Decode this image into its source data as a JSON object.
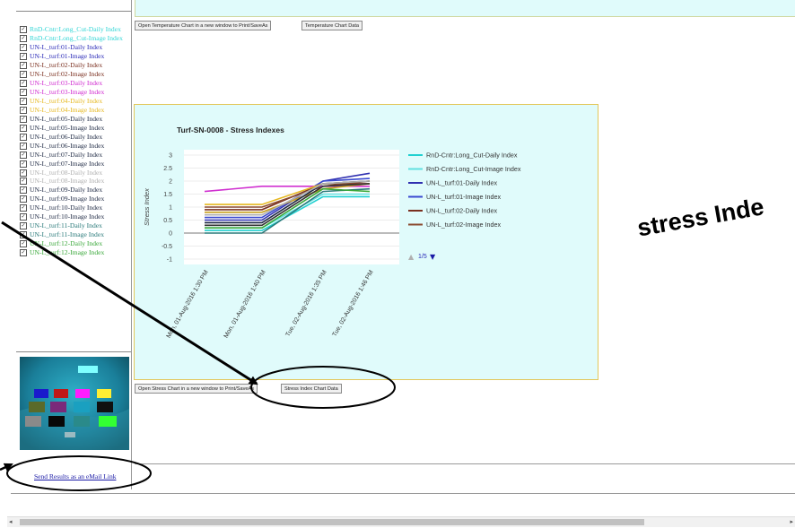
{
  "sidebar": {
    "series": [
      {
        "label": "RnD-Cntr:Long_Cut-Daily Index",
        "color": "#33d6d6",
        "checked": true
      },
      {
        "label": "RnD-Cntr:Long_Cut-Image Index",
        "color": "#33d6d6",
        "checked": true
      },
      {
        "label": "UN-L_turf:01-Daily Index",
        "color": "#2a2ab8",
        "checked": true
      },
      {
        "label": "UN-L_turf:01-Image Index",
        "color": "#2a2ab8",
        "checked": true
      },
      {
        "label": "UN-L_turf:02-Daily Index",
        "color": "#7a2e1e",
        "checked": true
      },
      {
        "label": "UN-L_turf:02-Image Index",
        "color": "#7a2e1e",
        "checked": true
      },
      {
        "label": "UN-L_turf:03-Daily Index",
        "color": "#d02ad0",
        "checked": true
      },
      {
        "label": "UN-L_turf:03-Image Index",
        "color": "#d02ad0",
        "checked": true
      },
      {
        "label": "UN-L_turf:04-Daily Index",
        "color": "#e6b820",
        "checked": true
      },
      {
        "label": "UN-L_turf:04-Image Index",
        "color": "#e6b820",
        "checked": true
      },
      {
        "label": "UN-L_turf:05-Daily Index",
        "color": "#1f2a44",
        "checked": true
      },
      {
        "label": "UN-L_turf:05-Image Index",
        "color": "#1f2a44",
        "checked": true
      },
      {
        "label": "UN-L_turf:06-Daily Index",
        "color": "#1f2a44",
        "checked": true
      },
      {
        "label": "UN-L_turf:06-Image Index",
        "color": "#1f2a44",
        "checked": true
      },
      {
        "label": "UN-L_turf:07-Daily Index",
        "color": "#1f2a44",
        "checked": true
      },
      {
        "label": "UN-L_turf:07-Image Index",
        "color": "#1f2a44",
        "checked": true
      },
      {
        "label": "UN-L_turf:08-Daily Index",
        "color": "#b0b0b0",
        "checked": true
      },
      {
        "label": "UN-L_turf:08-Image Index",
        "color": "#b0b0b0",
        "checked": true
      },
      {
        "label": "UN-L_turf:09-Daily Index",
        "color": "#1f2a44",
        "checked": true
      },
      {
        "label": "UN-L_turf:09-Image Index",
        "color": "#1f2a44",
        "checked": true
      },
      {
        "label": "UN-L_turf:10-Daily Index",
        "color": "#1f2a44",
        "checked": true
      },
      {
        "label": "UN-L_turf:10-Image Index",
        "color": "#1f2a44",
        "checked": true
      },
      {
        "label": "UN-L_turf:11-Daily Index",
        "color": "#2a7a7a",
        "checked": true
      },
      {
        "label": "UN-L_turf:11-Image Index",
        "color": "#2a7a7a",
        "checked": true
      },
      {
        "label": "UN-L_turf:12-Daily Index",
        "color": "#3aa83a",
        "checked": true
      },
      {
        "label": "UN-L_turf:12-Image Index",
        "color": "#3aa83a",
        "checked": true
      }
    ],
    "mail_link": "Send Results as an eMail Link"
  },
  "temperature": {
    "open_button": "Open Temperature Chart in a new window to Print/SaveAs",
    "data_button": "Temperature Chart Data"
  },
  "stress": {
    "open_button": "Open Stress Chart in a new window to Print/SaveAs",
    "data_button": "Stress Index Chart Data",
    "legend_pager": "1/5"
  },
  "callout": {
    "text": "stress Inde"
  },
  "chart_data": {
    "type": "line",
    "title": "Turf-SN-0008 - Stress Indexes",
    "ylabel": "Stress Index",
    "xlabel": "",
    "ylim": [
      -1,
      3
    ],
    "yticks": [
      3,
      2.5,
      2,
      1.5,
      1,
      0.5,
      0,
      -0.5,
      -1
    ],
    "categories": [
      "Mon, 01-Aug-2016 1:30 PM",
      "Mon, 01-Aug-2016 1:40 PM",
      "Tue, 02-Aug-2016 1:35 PM",
      "Tue, 02-Aug-2016 1:46 PM"
    ],
    "legend_position": "right",
    "series": [
      {
        "name": "RnD-Cntr:Long_Cut-Daily Index",
        "color": "#20d0d0",
        "values": [
          0.1,
          0.1,
          1.4,
          1.4
        ]
      },
      {
        "name": "RnD-Cntr:Long_Cut-Image Index",
        "color": "#60e0e0",
        "values": [
          0.2,
          0.2,
          1.5,
          1.5
        ]
      },
      {
        "name": "UN-L_turf:01-Daily Index",
        "color": "#3030b0",
        "values": [
          0.5,
          0.5,
          2.0,
          2.3
        ]
      },
      {
        "name": "UN-L_turf:01-Image Index",
        "color": "#3a4ad0",
        "values": [
          0.6,
          0.6,
          2.0,
          2.1
        ]
      },
      {
        "name": "UN-L_turf:02-Daily Index",
        "color": "#7a3020",
        "values": [
          0.9,
          0.9,
          1.9,
          1.9
        ]
      },
      {
        "name": "UN-L_turf:02-Image Index",
        "color": "#8a4a30",
        "values": [
          1.0,
          1.0,
          1.8,
          2.0
        ]
      },
      {
        "values": [
          1.6,
          1.8,
          1.8,
          1.8
        ],
        "color": "#d030d0"
      },
      {
        "values": [
          1.1,
          1.1,
          1.9,
          2.0
        ],
        "color": "#e6b820"
      },
      {
        "values": [
          0.8,
          0.8,
          1.7,
          1.9
        ],
        "color": "#c8a020"
      },
      {
        "values": [
          0.4,
          0.4,
          1.9,
          2.0
        ],
        "color": "#1f2a44"
      },
      {
        "values": [
          0.3,
          0.3,
          1.8,
          1.9
        ],
        "color": "#333333"
      },
      {
        "values": [
          0.0,
          0.0,
          1.6,
          1.7
        ],
        "color": "#2a7a7a"
      },
      {
        "values": [
          0.2,
          0.2,
          1.7,
          1.6
        ],
        "color": "#3aa83a"
      },
      {
        "values": [
          0.7,
          0.7,
          1.9,
          2.0
        ],
        "color": "#b0b0b0"
      }
    ]
  }
}
